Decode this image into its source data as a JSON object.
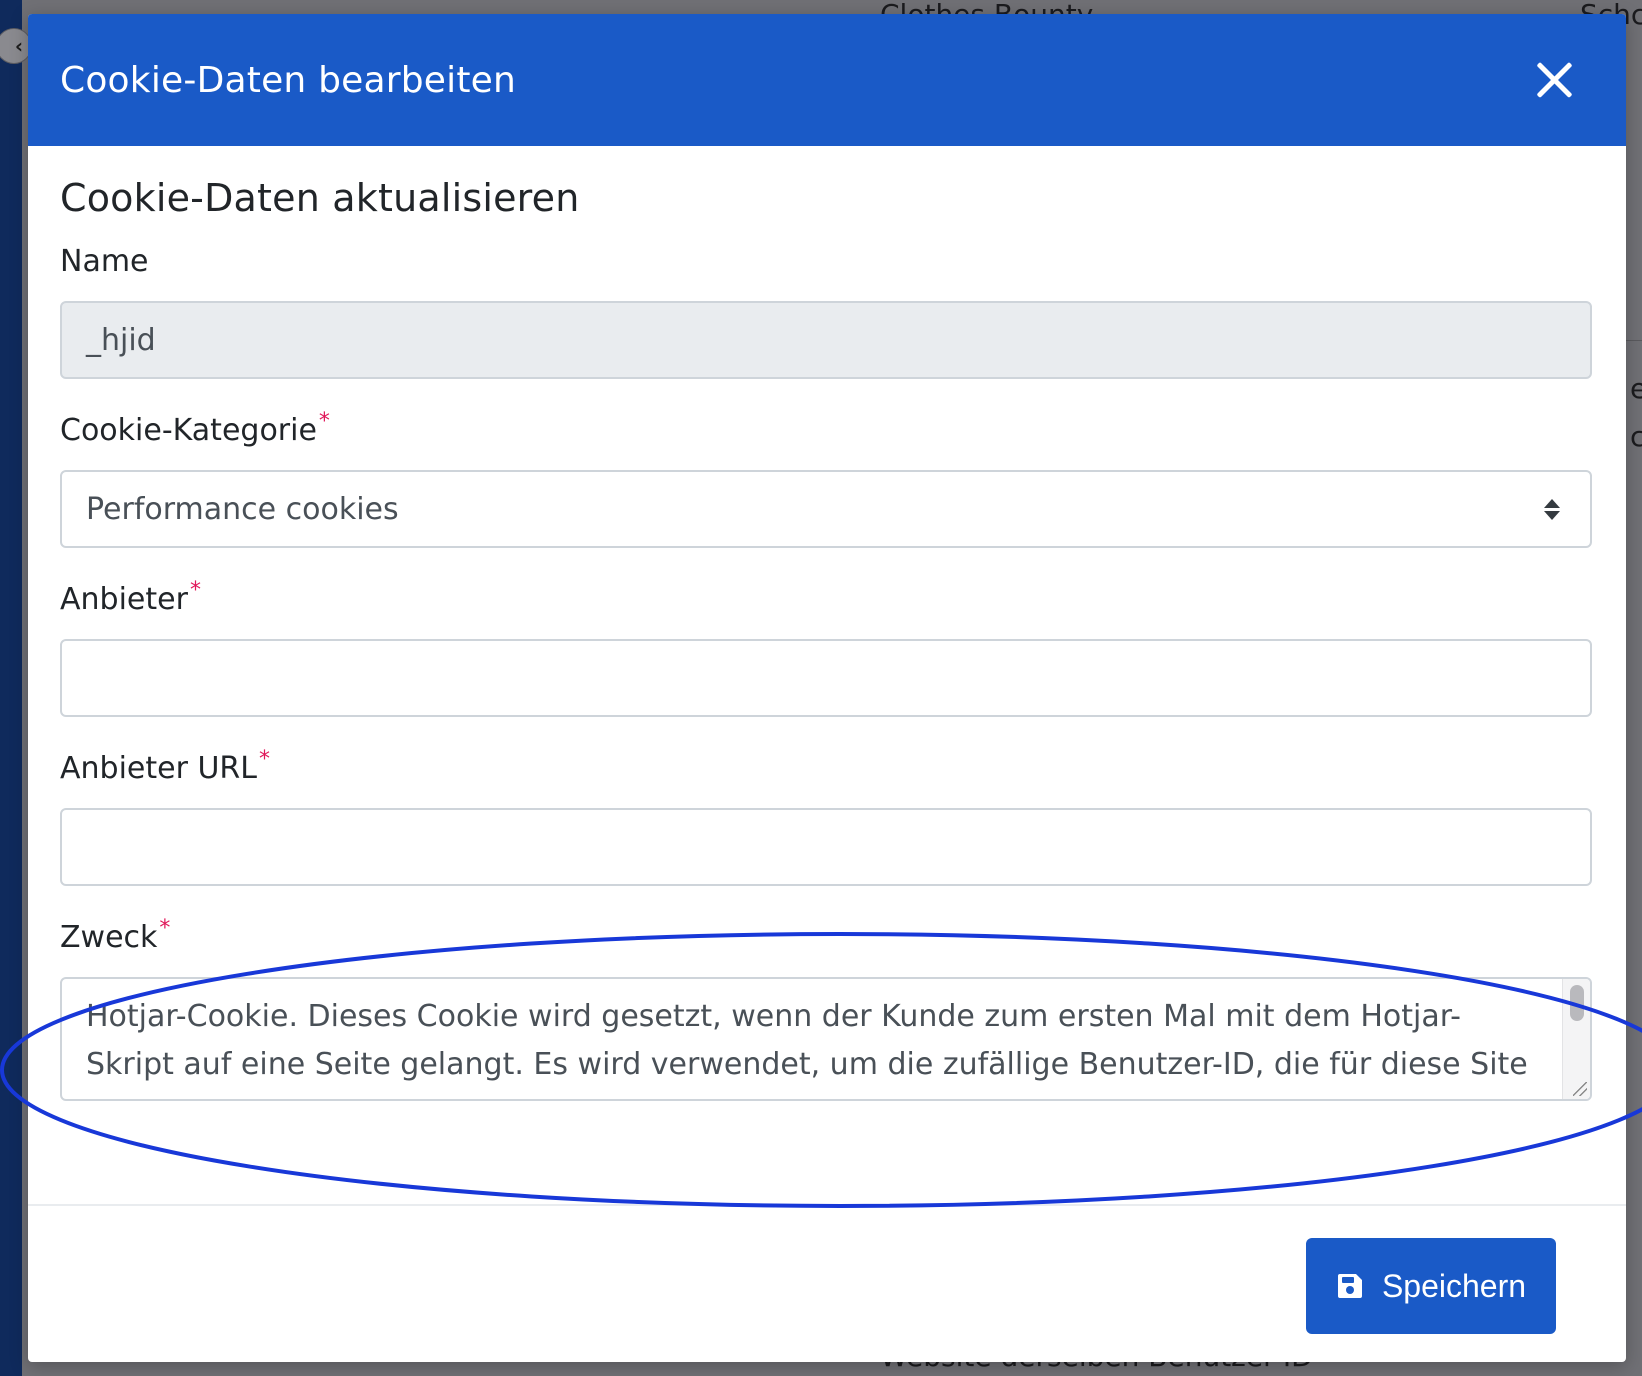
{
  "background": {
    "text_top_left": "Clothes Bounty",
    "text_top_right": "Schc",
    "text_bottom": "Website derselben Benutzer-ID",
    "edge_letters": [
      "e",
      "c"
    ]
  },
  "modal": {
    "title": "Cookie-Daten bearbeiten",
    "close_icon": "close-icon",
    "section_title": "Cookie-Daten aktualisieren",
    "fields": {
      "name": {
        "label": "Name",
        "value": "_hjid",
        "disabled": true
      },
      "category": {
        "label": "Cookie-Kategorie",
        "required_mark": "*",
        "selected": "Performance cookies"
      },
      "provider": {
        "label": "Anbieter",
        "required_mark": "*",
        "value": ""
      },
      "provider_url": {
        "label": "Anbieter URL",
        "required_mark": "*",
        "value": ""
      },
      "purpose": {
        "label": "Zweck",
        "required_mark": "*",
        "value": "Hotjar-Cookie. Dieses Cookie wird gesetzt, wenn der Kunde zum ersten Mal mit dem Hotjar-Skript auf eine Seite gelangt. Es wird verwendet, um die zufällige Benutzer-ID, die für diese Site"
      }
    },
    "footer": {
      "save_label": "Speichern",
      "save_icon": "floppy-disk-icon"
    }
  },
  "colors": {
    "header_blue": "#1a5ac7",
    "required_red": "#e0185a",
    "annotation_blue": "#1838d8"
  }
}
